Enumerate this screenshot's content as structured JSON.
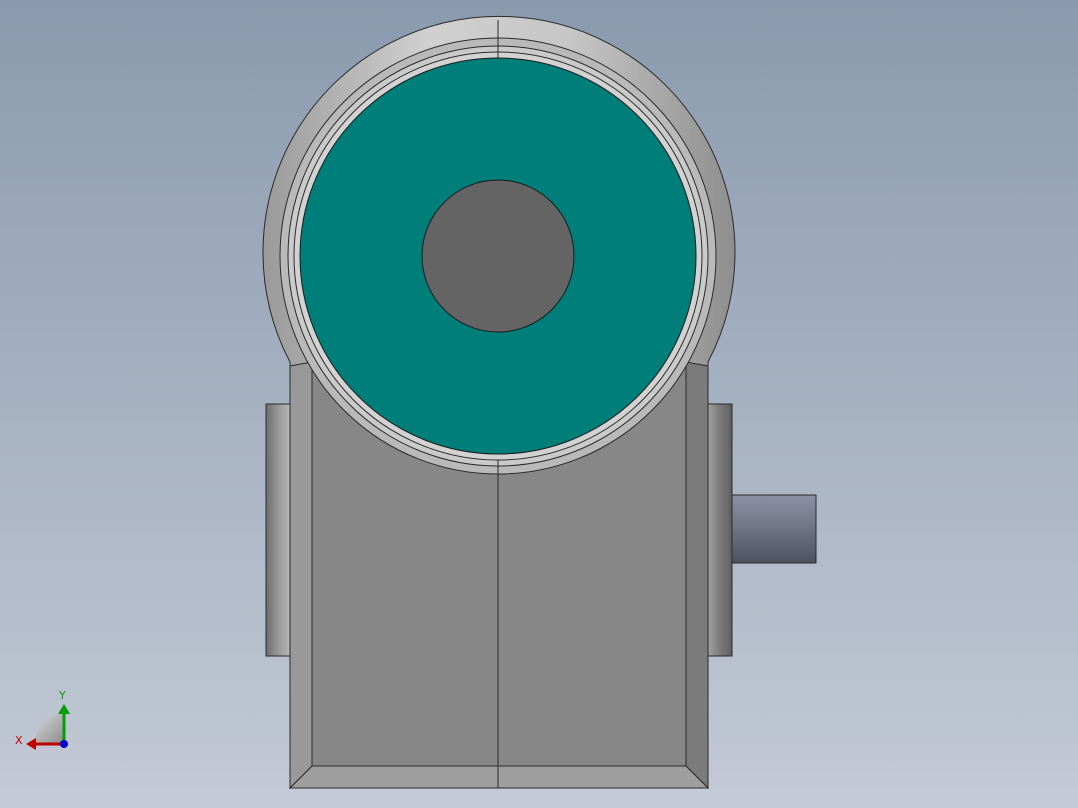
{
  "viewport": {
    "background_top": "#8a9aae",
    "background_bottom": "#c4cad6"
  },
  "model": {
    "housing_color": "#878787",
    "rim_color": "#c8c8c8",
    "face_color": "#007e7a",
    "bore_color": "#646464",
    "shaft_color": "#5e6272",
    "edge_color": "#2a2a2a"
  },
  "triad": {
    "x_label": "X",
    "y_label": "Y",
    "x_color": "#c00000",
    "y_color": "#00a000",
    "z_color": "#0000d0"
  }
}
